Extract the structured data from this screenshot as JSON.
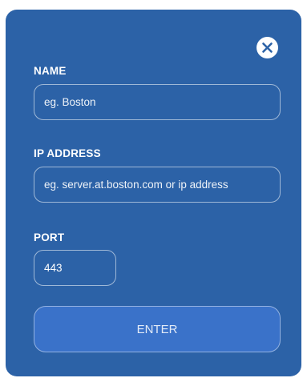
{
  "dialog": {
    "close_icon": "close-x-circle-icon",
    "fields": {
      "name": {
        "label": "NAME",
        "value": "",
        "placeholder": "eg. Boston"
      },
      "ip_address": {
        "label": "IP ADDRESS",
        "value": "",
        "placeholder": "eg. server.at.boston.com or ip address"
      },
      "port": {
        "label": "PORT",
        "value": "443",
        "placeholder": ""
      }
    },
    "enter_label": "ENTER"
  },
  "colors": {
    "page_background": "#ffffff",
    "dialog_background": "#2c62a7",
    "button_background": "#3a72c9",
    "text": "#ffffff"
  }
}
